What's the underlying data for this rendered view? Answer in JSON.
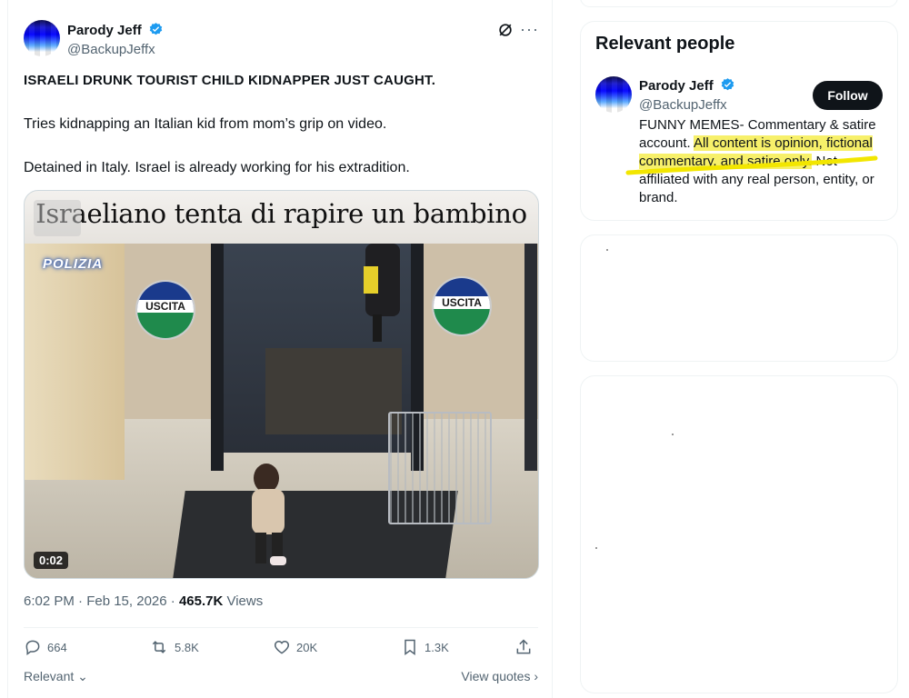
{
  "tweet": {
    "author": {
      "name": "Parody Jeff",
      "handle": "@BackupJeffx"
    },
    "headline": "ISRAELI DRUNK TOURIST CHILD KIDNAPPER JUST CAUGHT.",
    "line1": "Tries kidnapping an Italian kid from mom’s grip on video.",
    "line2": "Detained in Italy. Israel is already working  for his extradition.",
    "media": {
      "caption": "Israeliano tenta di rapire un bambino",
      "watermark": "POLIZIA",
      "sign_text": "USCITA",
      "duration": "0:02"
    },
    "timestamp": "6:02 PM · Feb 15, 2026 · ",
    "views_count": "465.7K",
    "views_label": " Views",
    "actions": {
      "replies": "664",
      "reposts": "5.8K",
      "likes": "20K",
      "bookmarks": "1.3K"
    },
    "relevant_label": "Relevant",
    "view_quotes": "View quotes"
  },
  "sidebar": {
    "relevant_title": "Relevant people",
    "person": {
      "name": "Parody Jeff",
      "handle": "@BackupJeffx",
      "follow_label": "Follow",
      "bio_part1": "FUNNY MEMES- Commentary & satire account. ",
      "bio_highlight": "All content is opinion, fictional commentary, and satire only.",
      "bio_part2": " Not affiliated with any real person, entity, or brand."
    }
  },
  "colors": {
    "accent": "#1d9bf0",
    "highlight": "#f7f06a",
    "text": "#0f1419",
    "muted": "#536471"
  }
}
